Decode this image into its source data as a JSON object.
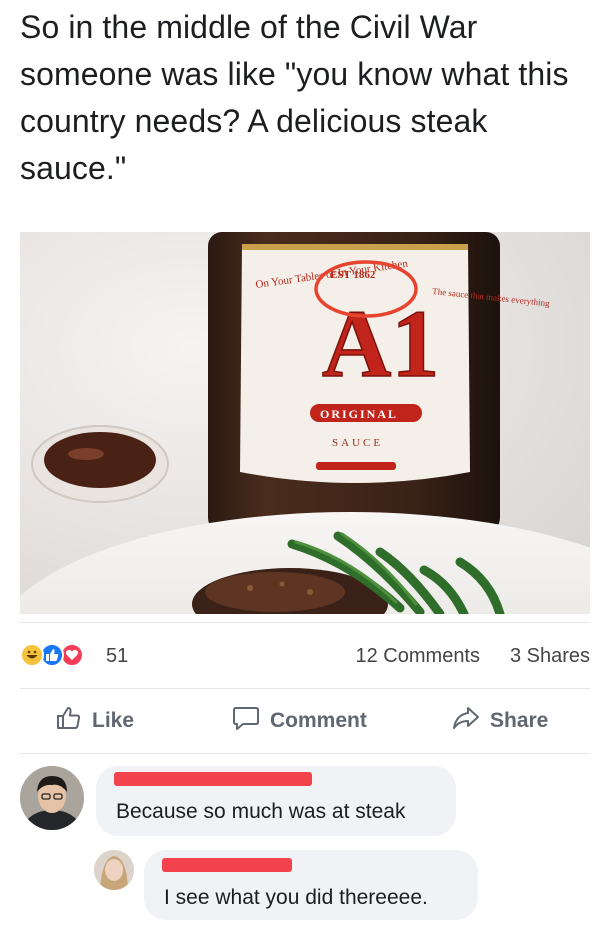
{
  "post": {
    "text": "So in the middle of the Civil War someone was like \"you know what this country needs? A delicious steak sauce.\""
  },
  "photo": {
    "label_text_left": "On Your Tables or In Your Kitchen",
    "est": "EST 1862",
    "brand": "A1",
    "original": "ORIGINAL",
    "sauce": "SAUCE",
    "right_side": "The sauce that makes everything"
  },
  "reactions": {
    "count": "51",
    "comments": "12 Comments",
    "shares": "3 Shares",
    "icons": [
      "haha-icon",
      "like-icon",
      "love-icon"
    ]
  },
  "actions": {
    "like": "Like",
    "comment": "Comment",
    "share": "Share"
  },
  "comments": [
    {
      "text": "Because so much was at steak"
    },
    {
      "text": "I see what you did thereeee."
    }
  ],
  "colors": {
    "like_blue": "#1877f2",
    "love_red": "#f33e58",
    "haha_yellow": "#f7c23b",
    "redaction": "#f2434c",
    "bubble": "#f0f2f5"
  }
}
